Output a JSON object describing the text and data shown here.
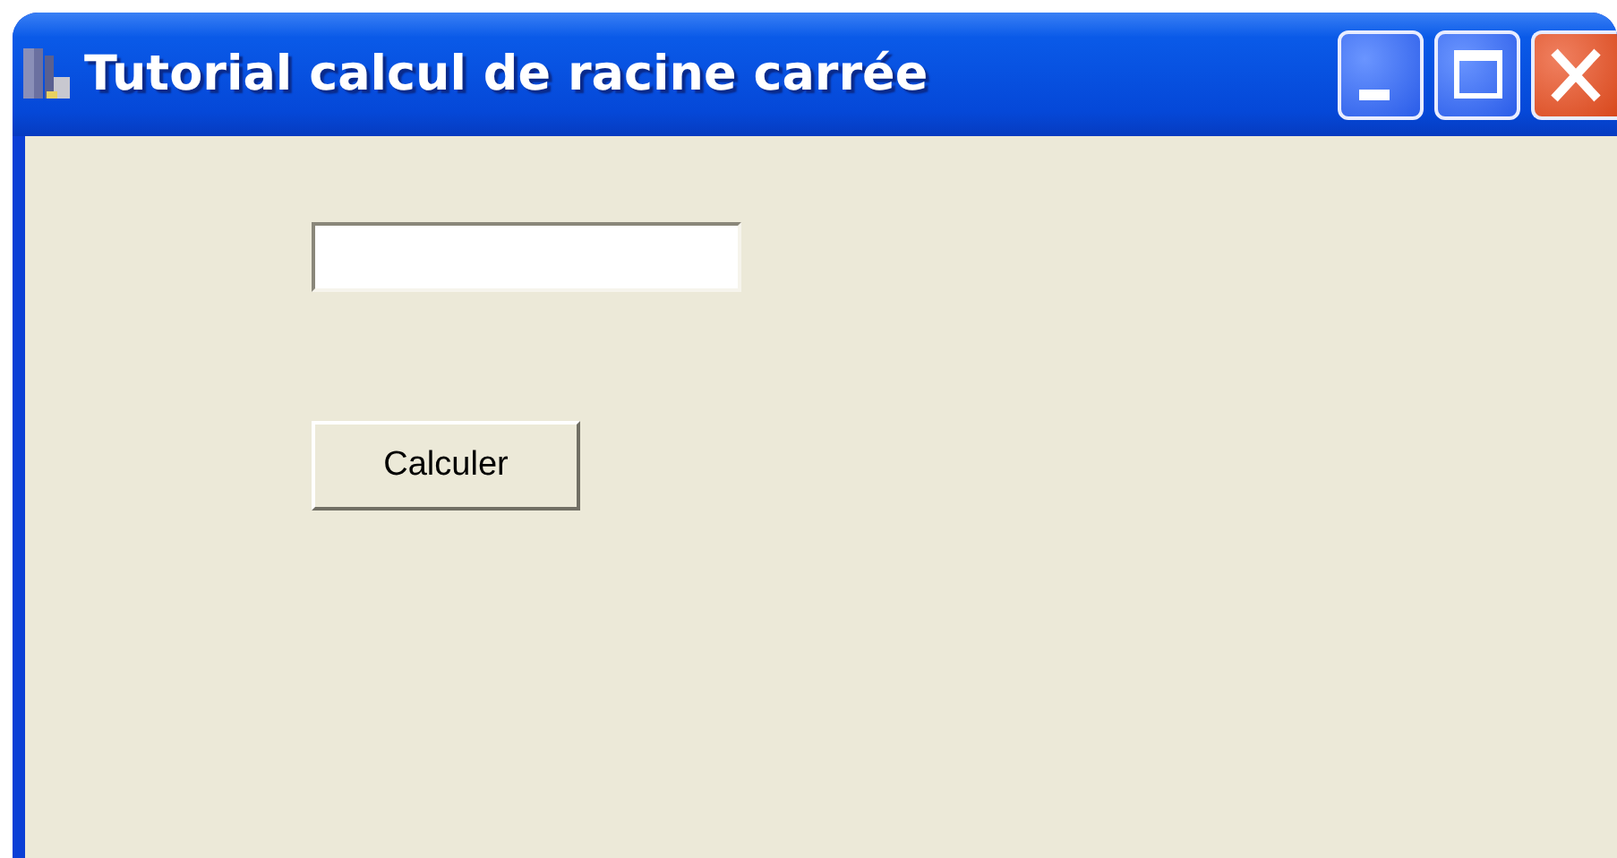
{
  "window": {
    "title": "Tutorial calcul de racine carrée"
  },
  "button": {
    "label": "Calculer"
  }
}
